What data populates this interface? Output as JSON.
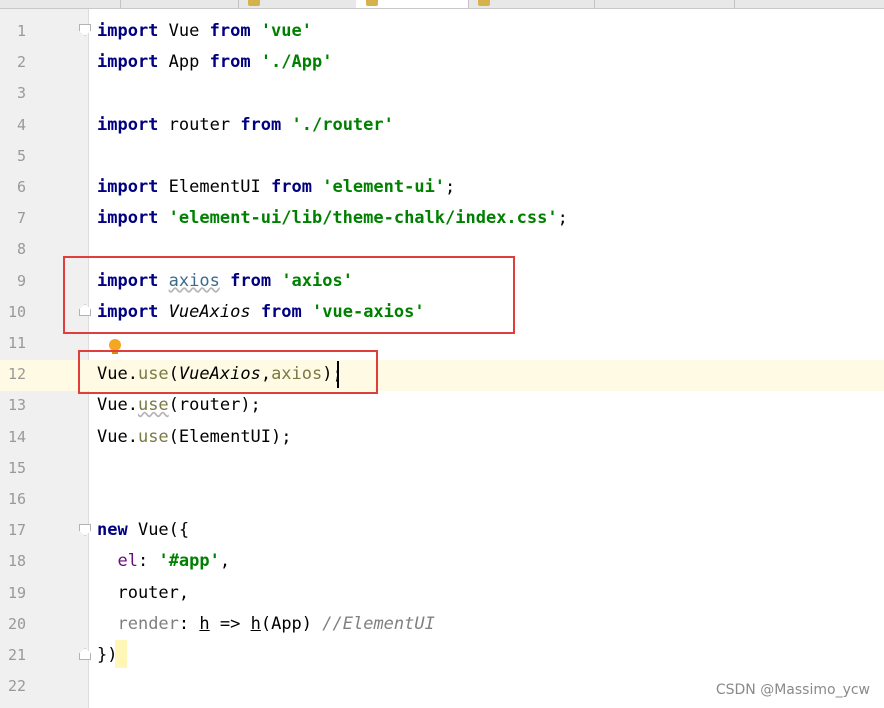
{
  "editor": {
    "lines": [
      {
        "n": "1",
        "parts": [
          {
            "t": "import",
            "c": "kw"
          },
          {
            "t": " Vue "
          },
          {
            "t": "from",
            "c": "kw"
          },
          {
            "t": " "
          },
          {
            "t": "'vue'",
            "c": "str"
          }
        ]
      },
      {
        "n": "2",
        "parts": [
          {
            "t": "import",
            "c": "kw"
          },
          {
            "t": " App "
          },
          {
            "t": "from",
            "c": "kw"
          },
          {
            "t": " "
          },
          {
            "t": "'./App'",
            "c": "str"
          }
        ]
      },
      {
        "n": "3",
        "parts": []
      },
      {
        "n": "4",
        "parts": [
          {
            "t": "import",
            "c": "kw"
          },
          {
            "t": " router "
          },
          {
            "t": "from",
            "c": "kw"
          },
          {
            "t": " "
          },
          {
            "t": "'./router'",
            "c": "str"
          }
        ]
      },
      {
        "n": "5",
        "parts": []
      },
      {
        "n": "6",
        "parts": [
          {
            "t": "import",
            "c": "kw"
          },
          {
            "t": " ElementUI "
          },
          {
            "t": "from",
            "c": "kw"
          },
          {
            "t": " "
          },
          {
            "t": "'element-ui'",
            "c": "str"
          },
          {
            "t": ";"
          }
        ]
      },
      {
        "n": "7",
        "parts": [
          {
            "t": "import",
            "c": "kw"
          },
          {
            "t": " "
          },
          {
            "t": "'element-ui/lib/theme-chalk/index.css'",
            "c": "str"
          },
          {
            "t": ";"
          }
        ]
      },
      {
        "n": "8",
        "parts": []
      },
      {
        "n": "9",
        "parts": [
          {
            "t": "import",
            "c": "kw"
          },
          {
            "t": " "
          },
          {
            "t": "axios",
            "c": "mod"
          },
          {
            "t": " "
          },
          {
            "t": "from",
            "c": "kw"
          },
          {
            "t": " "
          },
          {
            "t": "'axios'",
            "c": "str"
          }
        ]
      },
      {
        "n": "10",
        "parts": [
          {
            "t": "import",
            "c": "kw"
          },
          {
            "t": " "
          },
          {
            "t": "VueAxios",
            "c": "cls"
          },
          {
            "t": " "
          },
          {
            "t": "from",
            "c": "kw"
          },
          {
            "t": " "
          },
          {
            "t": "'vue-axios'",
            "c": "str"
          }
        ]
      },
      {
        "n": "11",
        "parts": []
      },
      {
        "n": "12",
        "parts": [
          {
            "t": "Vue."
          },
          {
            "t": "use",
            "c": "fn"
          },
          {
            "t": "("
          },
          {
            "t": "VueAxios",
            "c": "cls"
          },
          {
            "t": ","
          },
          {
            "t": "axios",
            "c": "fn"
          },
          {
            "t": ");"
          }
        ]
      },
      {
        "n": "13",
        "parts": [
          {
            "t": "Vue."
          },
          {
            "t": "use",
            "c": "fn fnw"
          },
          {
            "t": "(router);"
          }
        ]
      },
      {
        "n": "14",
        "parts": [
          {
            "t": "Vue."
          },
          {
            "t": "use",
            "c": "fn"
          },
          {
            "t": "(ElementUI);"
          }
        ]
      },
      {
        "n": "15",
        "parts": []
      },
      {
        "n": "16",
        "parts": []
      },
      {
        "n": "17",
        "parts": [
          {
            "t": "new",
            "c": "kw"
          },
          {
            "t": " Vue({"
          }
        ]
      },
      {
        "n": "18",
        "parts": [
          {
            "t": "  "
          },
          {
            "t": "el",
            "c": "prop"
          },
          {
            "t": ": "
          },
          {
            "t": "'#app'",
            "c": "str"
          },
          {
            "t": ","
          }
        ]
      },
      {
        "n": "19",
        "parts": [
          {
            "t": "  router,"
          }
        ]
      },
      {
        "n": "20",
        "parts": [
          {
            "t": "  "
          },
          {
            "t": "render",
            "c": "dim"
          },
          {
            "t": ": "
          },
          {
            "t": "h",
            "c": "param"
          },
          {
            "t": " => "
          },
          {
            "t": "h",
            "c": "param"
          },
          {
            "t": "(App) "
          },
          {
            "t": "//ElementUI",
            "c": "cm"
          }
        ]
      },
      {
        "n": "21",
        "parts": [
          {
            "t": "})"
          }
        ]
      },
      {
        "n": "22",
        "parts": []
      }
    ]
  },
  "colors": {
    "keyword": "#000080",
    "string": "#008000",
    "highlight_box": "#e03d3d",
    "current_line": "#fffae3"
  },
  "icons": {
    "intention": "lightbulb-icon",
    "fold": "fold-marker-icon"
  },
  "watermark": "CSDN @Massimo_ycw"
}
